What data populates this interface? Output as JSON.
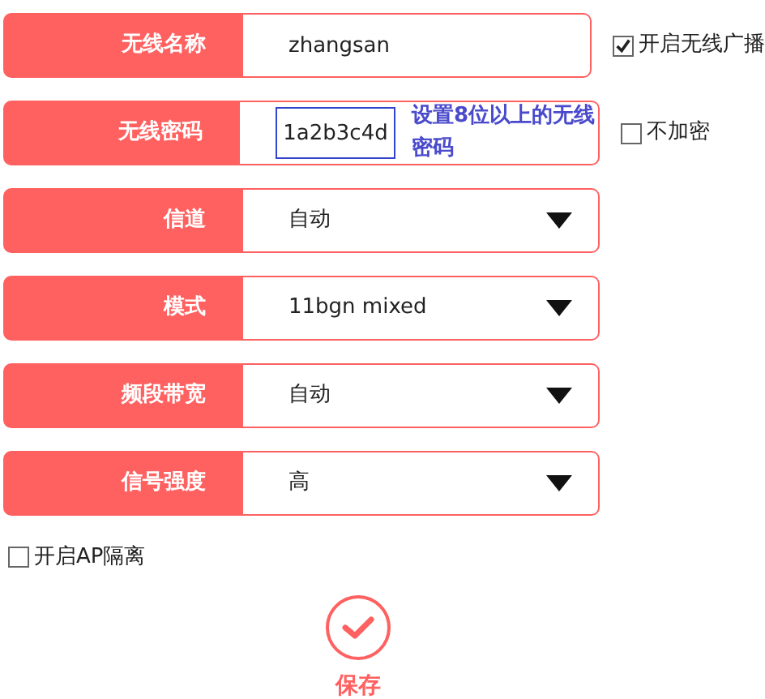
{
  "rows": [
    {
      "kind": "text",
      "label": "无线名称",
      "value": "zhangsan",
      "side_checkbox": {
        "label": "开启无线广播",
        "checked": true
      }
    },
    {
      "kind": "password",
      "label": "无线密码",
      "value": "1a2b3c4d",
      "hint": "设置8位以上的无线密码",
      "side_checkbox": {
        "label": "不加密",
        "checked": false
      }
    },
    {
      "kind": "select",
      "label": "信道",
      "value": "自动"
    },
    {
      "kind": "select",
      "label": "模式",
      "value": "11bgn mixed"
    },
    {
      "kind": "select",
      "label": "频段带宽",
      "value": "自动"
    },
    {
      "kind": "select",
      "label": "信号强度",
      "value": "高"
    }
  ],
  "ap_isolation": {
    "label": "开启AP隔离",
    "checked": false
  },
  "save_button": {
    "label": "保存"
  }
}
